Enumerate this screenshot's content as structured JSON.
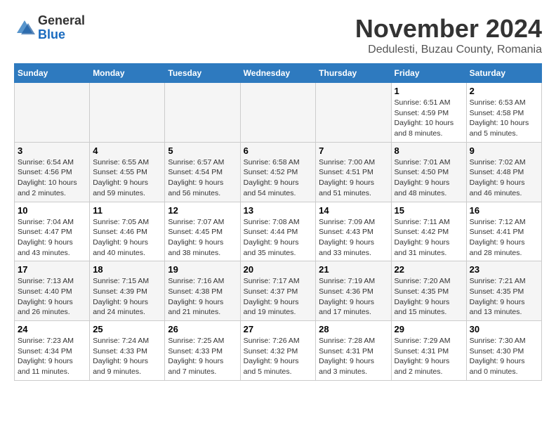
{
  "logo": {
    "general": "General",
    "blue": "Blue"
  },
  "title": "November 2024",
  "subtitle": "Dedulesti, Buzau County, Romania",
  "days_of_week": [
    "Sunday",
    "Monday",
    "Tuesday",
    "Wednesday",
    "Thursday",
    "Friday",
    "Saturday"
  ],
  "weeks": [
    [
      {
        "day": "",
        "info": ""
      },
      {
        "day": "",
        "info": ""
      },
      {
        "day": "",
        "info": ""
      },
      {
        "day": "",
        "info": ""
      },
      {
        "day": "",
        "info": ""
      },
      {
        "day": "1",
        "info": "Sunrise: 6:51 AM\nSunset: 4:59 PM\nDaylight: 10 hours and 8 minutes."
      },
      {
        "day": "2",
        "info": "Sunrise: 6:53 AM\nSunset: 4:58 PM\nDaylight: 10 hours and 5 minutes."
      }
    ],
    [
      {
        "day": "3",
        "info": "Sunrise: 6:54 AM\nSunset: 4:56 PM\nDaylight: 10 hours and 2 minutes."
      },
      {
        "day": "4",
        "info": "Sunrise: 6:55 AM\nSunset: 4:55 PM\nDaylight: 9 hours and 59 minutes."
      },
      {
        "day": "5",
        "info": "Sunrise: 6:57 AM\nSunset: 4:54 PM\nDaylight: 9 hours and 56 minutes."
      },
      {
        "day": "6",
        "info": "Sunrise: 6:58 AM\nSunset: 4:52 PM\nDaylight: 9 hours and 54 minutes."
      },
      {
        "day": "7",
        "info": "Sunrise: 7:00 AM\nSunset: 4:51 PM\nDaylight: 9 hours and 51 minutes."
      },
      {
        "day": "8",
        "info": "Sunrise: 7:01 AM\nSunset: 4:50 PM\nDaylight: 9 hours and 48 minutes."
      },
      {
        "day": "9",
        "info": "Sunrise: 7:02 AM\nSunset: 4:48 PM\nDaylight: 9 hours and 46 minutes."
      }
    ],
    [
      {
        "day": "10",
        "info": "Sunrise: 7:04 AM\nSunset: 4:47 PM\nDaylight: 9 hours and 43 minutes."
      },
      {
        "day": "11",
        "info": "Sunrise: 7:05 AM\nSunset: 4:46 PM\nDaylight: 9 hours and 40 minutes."
      },
      {
        "day": "12",
        "info": "Sunrise: 7:07 AM\nSunset: 4:45 PM\nDaylight: 9 hours and 38 minutes."
      },
      {
        "day": "13",
        "info": "Sunrise: 7:08 AM\nSunset: 4:44 PM\nDaylight: 9 hours and 35 minutes."
      },
      {
        "day": "14",
        "info": "Sunrise: 7:09 AM\nSunset: 4:43 PM\nDaylight: 9 hours and 33 minutes."
      },
      {
        "day": "15",
        "info": "Sunrise: 7:11 AM\nSunset: 4:42 PM\nDaylight: 9 hours and 31 minutes."
      },
      {
        "day": "16",
        "info": "Sunrise: 7:12 AM\nSunset: 4:41 PM\nDaylight: 9 hours and 28 minutes."
      }
    ],
    [
      {
        "day": "17",
        "info": "Sunrise: 7:13 AM\nSunset: 4:40 PM\nDaylight: 9 hours and 26 minutes."
      },
      {
        "day": "18",
        "info": "Sunrise: 7:15 AM\nSunset: 4:39 PM\nDaylight: 9 hours and 24 minutes."
      },
      {
        "day": "19",
        "info": "Sunrise: 7:16 AM\nSunset: 4:38 PM\nDaylight: 9 hours and 21 minutes."
      },
      {
        "day": "20",
        "info": "Sunrise: 7:17 AM\nSunset: 4:37 PM\nDaylight: 9 hours and 19 minutes."
      },
      {
        "day": "21",
        "info": "Sunrise: 7:19 AM\nSunset: 4:36 PM\nDaylight: 9 hours and 17 minutes."
      },
      {
        "day": "22",
        "info": "Sunrise: 7:20 AM\nSunset: 4:35 PM\nDaylight: 9 hours and 15 minutes."
      },
      {
        "day": "23",
        "info": "Sunrise: 7:21 AM\nSunset: 4:35 PM\nDaylight: 9 hours and 13 minutes."
      }
    ],
    [
      {
        "day": "24",
        "info": "Sunrise: 7:23 AM\nSunset: 4:34 PM\nDaylight: 9 hours and 11 minutes."
      },
      {
        "day": "25",
        "info": "Sunrise: 7:24 AM\nSunset: 4:33 PM\nDaylight: 9 hours and 9 minutes."
      },
      {
        "day": "26",
        "info": "Sunrise: 7:25 AM\nSunset: 4:33 PM\nDaylight: 9 hours and 7 minutes."
      },
      {
        "day": "27",
        "info": "Sunrise: 7:26 AM\nSunset: 4:32 PM\nDaylight: 9 hours and 5 minutes."
      },
      {
        "day": "28",
        "info": "Sunrise: 7:28 AM\nSunset: 4:31 PM\nDaylight: 9 hours and 3 minutes."
      },
      {
        "day": "29",
        "info": "Sunrise: 7:29 AM\nSunset: 4:31 PM\nDaylight: 9 hours and 2 minutes."
      },
      {
        "day": "30",
        "info": "Sunrise: 7:30 AM\nSunset: 4:30 PM\nDaylight: 9 hours and 0 minutes."
      }
    ]
  ]
}
